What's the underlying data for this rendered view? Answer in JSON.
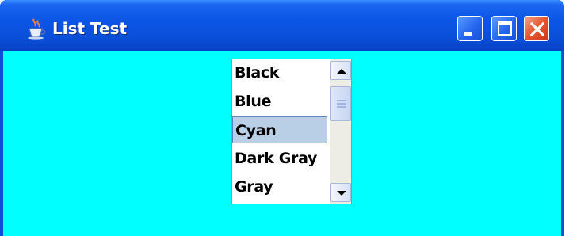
{
  "window": {
    "title": "List Test",
    "icon": "java-cup-icon",
    "buttons": [
      "minimize-icon",
      "maximize-icon",
      "close-icon"
    ],
    "client_background": "#00ffff"
  },
  "list": {
    "items": [
      {
        "label": "Black",
        "selected": false
      },
      {
        "label": "Blue",
        "selected": false
      },
      {
        "label": "Cyan",
        "selected": true
      },
      {
        "label": "Dark Gray",
        "selected": false
      },
      {
        "label": "Gray",
        "selected": false
      }
    ],
    "scrollbar": {
      "up_icon": "arrow-up-icon",
      "down_icon": "arrow-down-icon"
    }
  }
}
